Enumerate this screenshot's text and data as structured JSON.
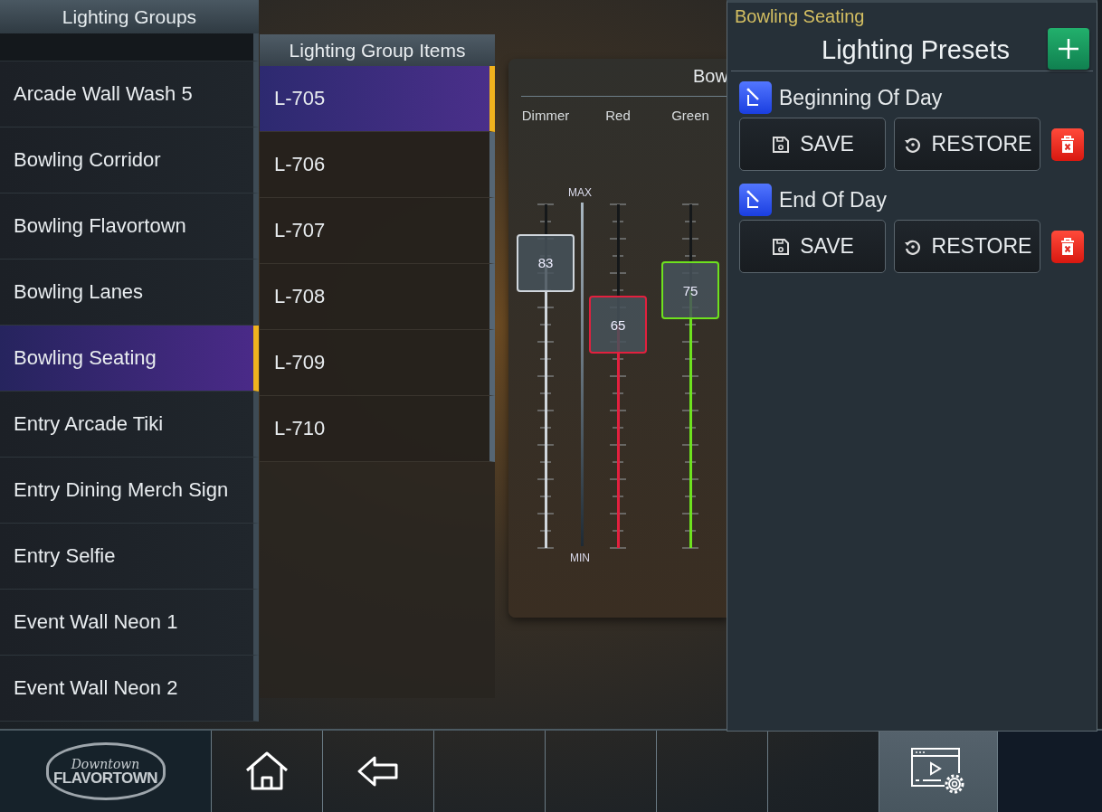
{
  "groups_panel": {
    "title": "Lighting Groups",
    "items": [
      {
        "label": "Arcade Wall Wash 5",
        "selected": false
      },
      {
        "label": "Bowling Corridor",
        "selected": false
      },
      {
        "label": "Bowling Flavortown",
        "selected": false
      },
      {
        "label": "Bowling Lanes",
        "selected": false
      },
      {
        "label": "Bowling Seating",
        "selected": true
      },
      {
        "label": "Entry Arcade Tiki",
        "selected": false
      },
      {
        "label": "Entry Dining Merch Sign",
        "selected": false
      },
      {
        "label": "Entry Selfie",
        "selected": false
      },
      {
        "label": "Event Wall Neon 1",
        "selected": false
      },
      {
        "label": "Event Wall Neon 2",
        "selected": false
      }
    ]
  },
  "items_panel": {
    "title": "Lighting Group Items",
    "items": [
      {
        "label": "L-705",
        "selected": true
      },
      {
        "label": "L-706",
        "selected": false
      },
      {
        "label": "L-707",
        "selected": false
      },
      {
        "label": "L-708",
        "selected": false
      },
      {
        "label": "L-709",
        "selected": false
      },
      {
        "label": "L-710",
        "selected": false
      }
    ]
  },
  "mixer": {
    "title": "Bow",
    "scale_max": "MAX",
    "scale_min": "MIN",
    "channels": [
      {
        "name": "Dimmer",
        "level": 0.83,
        "reading": "83",
        "color": "#d0d6dc"
      },
      {
        "name": "Red",
        "level": 0.65,
        "reading": "65",
        "color": "#e2203e"
      },
      {
        "name": "Green",
        "level": 0.75,
        "reading": "75",
        "color": "#6ee21e"
      }
    ]
  },
  "presets": {
    "group": "Bowling Seating",
    "title": "Lighting Presets",
    "items": [
      {
        "name": "Beginning Of Day",
        "save": "SAVE",
        "restore": "RESTORE"
      },
      {
        "name": "End Of Day",
        "save": "SAVE",
        "restore": "RESTORE"
      }
    ]
  },
  "nav": {
    "logo": [
      "Downtown",
      "FLAVORTOWN"
    ],
    "tabs": [
      {
        "kind": "home",
        "selected": false
      },
      {
        "kind": "back",
        "selected": false
      },
      {
        "kind": "blank",
        "selected": false
      },
      {
        "kind": "blank",
        "selected": false
      },
      {
        "kind": "blank",
        "selected": false
      },
      {
        "kind": "blank",
        "selected": false
      },
      {
        "kind": "settings",
        "selected": true
      },
      {
        "kind": "blank",
        "selected": false
      }
    ]
  }
}
